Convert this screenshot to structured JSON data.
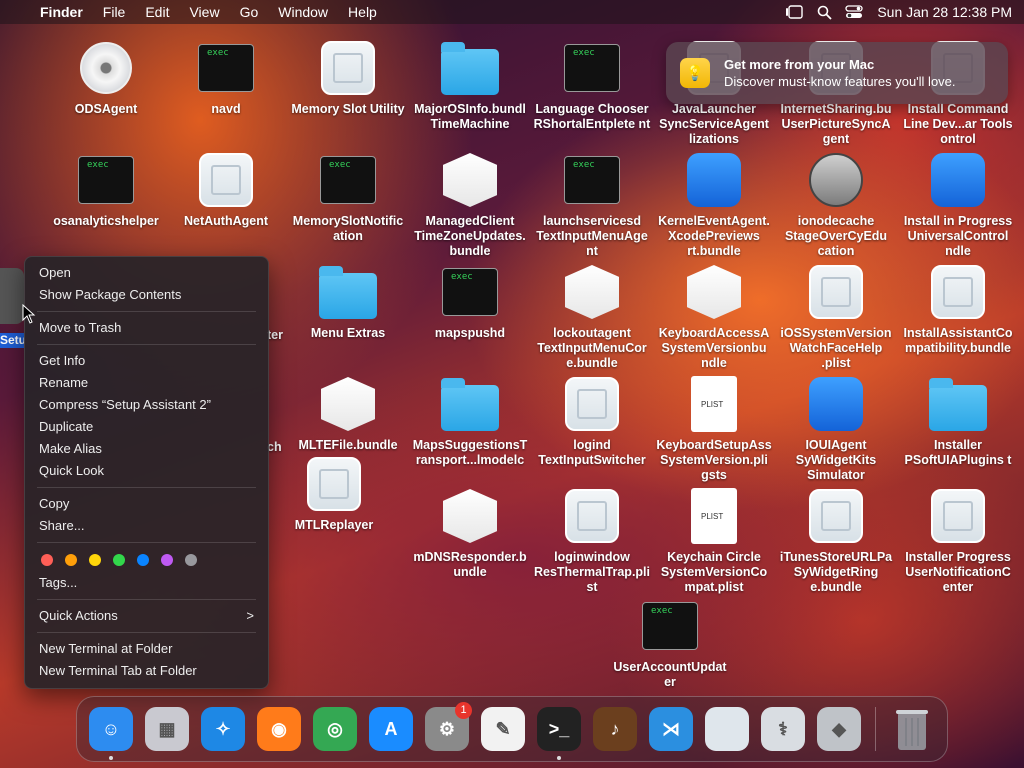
{
  "menubar": {
    "app_name": "Finder",
    "menus": [
      "File",
      "Edit",
      "View",
      "Go",
      "Window",
      "Help"
    ],
    "clock": "Sun Jan 28  12:38 PM"
  },
  "desktop_items": [
    {
      "label": "ODSAgent",
      "kind": "cd"
    },
    {
      "label": "navd",
      "kind": "exec"
    },
    {
      "label": "Memory Slot Utility",
      "kind": "blank"
    },
    {
      "label": "MajorOSInfo.bundl TimeMachine",
      "kind": "folder"
    },
    {
      "label": "Language Chooser RShortalEntplete nt",
      "kind": "exec"
    },
    {
      "label": "JavaLauncher SyncServiceAgent lizations",
      "kind": "blank"
    },
    {
      "label": "InternetSharing.bu UserPictureSyncA gent",
      "kind": "blank"
    },
    {
      "label": "Install Command Line Dev...ar Tools ontrol",
      "kind": "blank"
    },
    {
      "label": "osanalyticshelper",
      "kind": "exec"
    },
    {
      "label": "NetAuthAgent",
      "kind": "blank"
    },
    {
      "label": "MemorySlotNotific ation",
      "kind": "exec"
    },
    {
      "label": "ManagedClient TimeZoneUpdates. bundle",
      "kind": "bundle"
    },
    {
      "label": "launchservicesd TextInputMenuAge nt",
      "kind": "exec"
    },
    {
      "label": "KernelEventAgent. XcodePreviews rt.bundle",
      "kind": "app-blue"
    },
    {
      "label": "ionodecache StageOverCyEdu cation",
      "kind": "app-gray"
    },
    {
      "label": "Install in Progress UniversalControl ndle",
      "kind": "app-blue"
    },
    {
      "label": "Menu Extras",
      "kind": "folder"
    },
    {
      "label": "mapspushd",
      "kind": "exec"
    },
    {
      "label": "lockoutagent TextInputMenuCor e.bundle",
      "kind": "bundle"
    },
    {
      "label": "KeyboardAccessA SystemVersionbu ndle",
      "kind": "bundle"
    },
    {
      "label": "iOSSystemVersion WatchFaceHelp .plist",
      "kind": "blank"
    },
    {
      "label": "InstallAssistantCo mpatibility.bundle",
      "kind": "blank"
    },
    {
      "label": "MLTEFile.bundle",
      "kind": "bundle"
    },
    {
      "label": "MapsSuggestionsT ransport...lmodelc",
      "kind": "folder"
    },
    {
      "label": "logind TextInputSwitcher",
      "kind": "blank"
    },
    {
      "label": "KeyboardSetupAss SystemVersion.pli gsts",
      "kind": "plist"
    },
    {
      "label": "IOUIAgent SyWidgetKits Simulator",
      "kind": "app-blue"
    },
    {
      "label": "Installer PSoftUIAPlugins t",
      "kind": "folder"
    },
    {
      "label": "MTLReplayer",
      "kind": "blank"
    },
    {
      "label": "mDNSResponder.b undle",
      "kind": "bundle"
    },
    {
      "label": "loginwindow ResThermalTrap.pli st",
      "kind": "blank"
    },
    {
      "label": "Keychain Circle SystemVersionCo mpat.plist",
      "kind": "plist"
    },
    {
      "label": "iTunesStoreURLPa SyWidgetRing e.bundle",
      "kind": "blank"
    },
    {
      "label": "Installer Progress UserNotificationC enter",
      "kind": "blank"
    },
    {
      "label": "UserAccountUpdat er",
      "kind": "exec"
    }
  ],
  "partial_labels": {
    "left1": "ter",
    "left2": "ch"
  },
  "selected_item_label": "Setup Assistant 2",
  "notification": {
    "title": "Get more from your Mac",
    "body": "Discover must-know features you'll love."
  },
  "context_menu": {
    "group1": [
      "Open",
      "Show Package Contents"
    ],
    "group2": [
      "Move to Trash"
    ],
    "group3": [
      "Get Info",
      "Rename",
      "Compress “Setup Assistant 2”",
      "Duplicate",
      "Make Alias",
      "Quick Look"
    ],
    "group4": [
      "Copy",
      "Share..."
    ],
    "tags_label": "Tags...",
    "tag_colors": [
      "#ff5f57",
      "#ff9f0a",
      "#ffd60a",
      "#32d74b",
      "#0a84ff",
      "#bf5af2",
      "#98989d"
    ],
    "quick_actions": "Quick Actions",
    "quick_actions_chevron": ">",
    "group6": [
      "New Terminal at Folder",
      "New Terminal Tab at Folder"
    ]
  },
  "dock": {
    "apps": [
      {
        "name": "finder-icon",
        "color": "#2d8cf0",
        "glyph": "☺",
        "running": true
      },
      {
        "name": "launchpad-icon",
        "color": "#c9c9d0",
        "glyph": "▦",
        "running": false
      },
      {
        "name": "safari-icon",
        "color": "#1e88e5",
        "glyph": "✧",
        "running": false
      },
      {
        "name": "firefox-icon",
        "color": "#ff7b1a",
        "glyph": "◉",
        "running": false
      },
      {
        "name": "chrome-icon",
        "color": "#34a853",
        "glyph": "◎",
        "running": false
      },
      {
        "name": "app-store-icon",
        "color": "#1a8cff",
        "glyph": "A",
        "running": false
      },
      {
        "name": "system-settings-icon",
        "color": "#8a8a8a",
        "glyph": "⚙",
        "running": false,
        "badge": "1"
      },
      {
        "name": "textedit-icon",
        "color": "#f2f2f2",
        "glyph": "✎",
        "running": false
      },
      {
        "name": "terminal-icon",
        "color": "#222222",
        "glyph": ">_",
        "running": true
      },
      {
        "name": "garageband-icon",
        "color": "#6b3f1e",
        "glyph": "♪",
        "running": false
      },
      {
        "name": "vscode-icon",
        "color": "#2b8fe0",
        "glyph": "⋊",
        "running": false
      },
      {
        "name": "generic-app-icon",
        "color": "#dfe6ec",
        "glyph": "",
        "running": false
      },
      {
        "name": "disk-utility-icon",
        "color": "#d9dde2",
        "glyph": "⚕",
        "running": false
      },
      {
        "name": "boot-camp-icon",
        "color": "#bfc3c8",
        "glyph": "◆",
        "running": false
      }
    ],
    "trash": {
      "name": "trash-icon",
      "color": "#9aa0a6"
    }
  }
}
